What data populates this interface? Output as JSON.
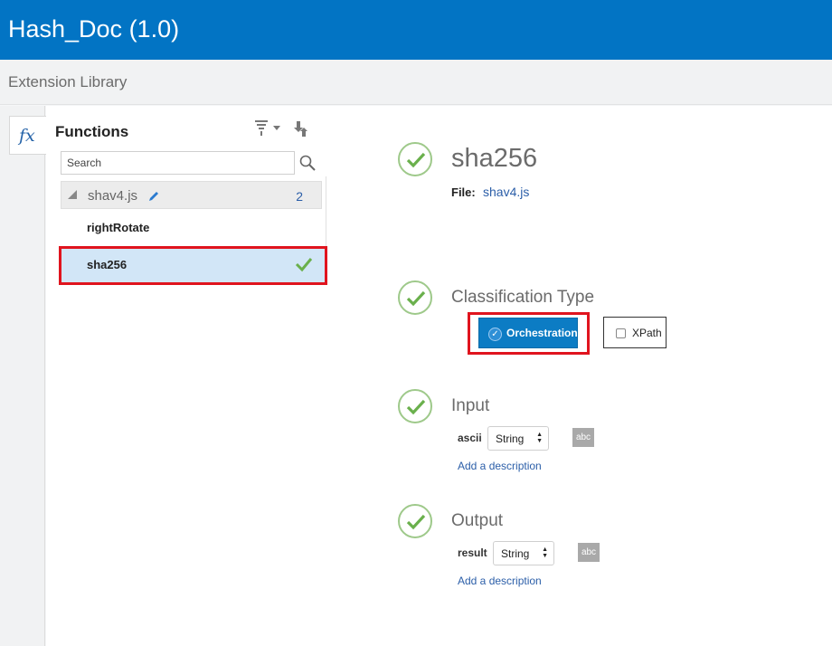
{
  "header": {
    "title": "Hash_Doc (1.0)"
  },
  "subheader": {
    "title": "Extension Library"
  },
  "left_rail": {
    "tab_glyph": "fx"
  },
  "functions_panel": {
    "title": "Functions",
    "search": {
      "placeholder": "Search",
      "value": ""
    },
    "group": {
      "name": "shav4.js",
      "count": "2"
    },
    "items": [
      {
        "label": "rightRotate",
        "selected": false
      },
      {
        "label": "sha256",
        "selected": true
      }
    ]
  },
  "detail": {
    "name": "sha256",
    "file_label": "File:",
    "file_link": "shav4.js",
    "classification": {
      "title": "Classification Type",
      "options": [
        {
          "label": "Orchestration",
          "checked": true
        },
        {
          "label": "XPath",
          "checked": false
        }
      ]
    },
    "input": {
      "title": "Input",
      "param_name": "ascii",
      "type": "String",
      "badge": "abc",
      "add_description": "Add a description"
    },
    "output": {
      "title": "Output",
      "param_name": "result",
      "type": "String",
      "badge": "abc",
      "add_description": "Add a description"
    }
  },
  "colors": {
    "header_bg": "#0274c4",
    "accent_blue": "#0c7cc4",
    "link_blue": "#2b5ea8",
    "check_green": "#6ab04c",
    "highlight_red": "#e0141e",
    "selected_row": "#d2e6f7"
  },
  "icons": [
    "fx-icon",
    "filter-icon",
    "download-icon",
    "search-icon",
    "pencil-icon",
    "checkmark-icon",
    "step-complete-icon"
  ]
}
